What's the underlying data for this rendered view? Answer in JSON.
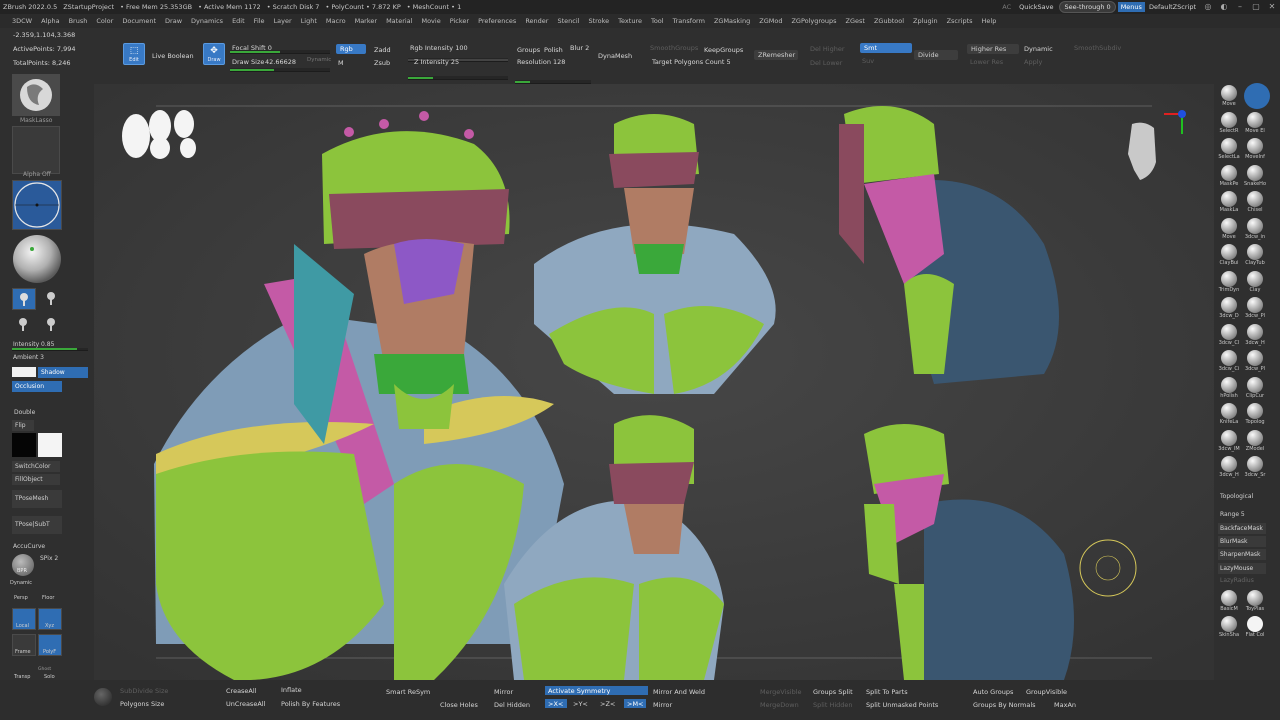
{
  "titlebar": {
    "app": "ZBrush 2022.0.5",
    "project": "ZStartupProject",
    "free_mem": "• Free Mem 25.353GB",
    "active_mem": "• Active Mem 1172",
    "scratch": "• Scratch Disk 7",
    "polycount": "• PolyCount • 7.872 KP",
    "meshcount": "• MeshCount • 1",
    "ac": "AC",
    "quicksave": "QuickSave",
    "see_through": "See-through  0",
    "menus": "Menus",
    "script": "DefaultZScript"
  },
  "menubar": [
    "3DCW",
    "Alpha",
    "Brush",
    "Color",
    "Document",
    "Draw",
    "Dynamics",
    "Edit",
    "File",
    "Layer",
    "Light",
    "Macro",
    "Marker",
    "Material",
    "Movie",
    "Picker",
    "Preferences",
    "Render",
    "Stencil",
    "Stroke",
    "Texture",
    "Tool",
    "Transform",
    "ZGMasking",
    "ZGMod",
    "ZGPolygroups",
    "ZGest",
    "ZGubtool",
    "Zplugin",
    "Zscripts",
    "Help"
  ],
  "info": {
    "coords": "-2.359,1.104,3.368",
    "active_points": "ActivePoints: 7,994",
    "total_points": "TotalPoints: 8,246"
  },
  "toolbar": {
    "edit": "Edit",
    "live_boolean": "Live Boolean",
    "draw": "Draw",
    "focal_shift": "Focal Shift 0",
    "draw_size": "Draw Size",
    "draw_size_value": "42.66628",
    "dynamic": "Dynamic",
    "rgb": "Rgb",
    "m": "M",
    "zadd": "Zadd",
    "zsub": "Zsub",
    "rgb_intensity": "Rgb Intensity 100",
    "z_intensity": "Z Intensity 25",
    "groups": "Groups",
    "polish": "Polish",
    "blur": "Blur 2",
    "resolution": "Resolution 128",
    "dynamesh": "DynaMesh",
    "smooth_groups": "SmoothGroups",
    "keep_groups": "KeepGroups",
    "target_polygons": "Target Polygons Count 5",
    "zremesher": "ZRemesher",
    "del_higher": "Del Higher",
    "del_lower": "Del Lower",
    "smt": "Smt",
    "suv": "Suv",
    "divide": "Divide",
    "higher_res": "Higher Res",
    "lower_res": "Lower Res",
    "dynamic2": "Dynamic",
    "apply": "Apply",
    "smooth_subdiv": "SmoothSubdiv"
  },
  "left": {
    "mask_lasso": "MaskLasso",
    "alpha_off": "Alpha Off",
    "intensity": "Intensity 0.85",
    "ambient": "Ambient 3",
    "shadow": "Shadow",
    "occlusion": "Occlusion",
    "double": "Double",
    "flip": "Flip",
    "switch_color": "SwitchColor",
    "fill_object": "FillObject",
    "tpose_mesh": "TPoseMesh",
    "tpose_subt": "TPose|SubT",
    "accucurve": "AccuCurve",
    "spix": "SPix 2",
    "bpr": "BPR",
    "dynamic": "Dynamic",
    "persp": "Persp",
    "floor": "Floor",
    "local": "Local",
    "xyz": "Xyz",
    "frame": "Frame",
    "polyf": "PolyF",
    "transp": "Transp",
    "solo": "Solo",
    "ghost": "Ghost"
  },
  "right": {
    "brushes": [
      {
        "l": "Move",
        "r": ""
      },
      {
        "l": "SelectR",
        "r": "Move El"
      },
      {
        "l": "SelectLa",
        "r": "MoveInf"
      },
      {
        "l": "MaskPe",
        "r": "SnakeHo"
      },
      {
        "l": "MaskLa",
        "r": "Chisel"
      },
      {
        "l": "Move",
        "r": "3dcw_in"
      },
      {
        "l": "ClayBui",
        "r": "ClayTub"
      },
      {
        "l": "TrimDyn",
        "r": "Clay"
      },
      {
        "l": "3dcw_D",
        "r": "3dcw_Pl"
      },
      {
        "l": "3dcw_Cl",
        "r": "3dcw_H"
      },
      {
        "l": "3dcw_Ci",
        "r": "3dcw_Pl"
      },
      {
        "l": "hPolish",
        "r": "ClipCur"
      },
      {
        "l": "KnifeLa",
        "r": "Topolog"
      },
      {
        "l": "3dcw_IM",
        "r": "ZModel"
      },
      {
        "l": "3dcw_H",
        "r": "3dcw_Sr"
      }
    ],
    "topological": "Topological",
    "range": "Range 5",
    "backface_mask": "BackfaceMask",
    "blur_mask": "BlurMask",
    "sharpen_mask": "SharpenMask",
    "lazy_mouse": "LazyMouse",
    "lazy_radius": "LazyRadius",
    "basic_m": "BasicM",
    "toy_plas": "ToyPlas",
    "skin_sha": "SkinSha",
    "flat_col": "Flat Col"
  },
  "bottom": {
    "subdivide_size": "SubDivide Size",
    "polygons_size": "Polygons Size",
    "crease_all": "CreaseAll",
    "uncrease_all": "UnCreaseAll",
    "inflate": "Inflate",
    "polish_by_features": "Polish By Features",
    "smart_resym": "Smart ReSym",
    "close_holes": "Close Holes",
    "mirror": "Mirror",
    "del_hidden": "Del Hidden",
    "activate_symmetry": "Activate Symmetry",
    "mx": ">X<",
    "my": ">Y<",
    "mz": ">Z<",
    "m": ">M<",
    "mirror_and_weld": "Mirror And Weld",
    "mirror2": "Mirror",
    "merge_visible": "MergeVisible",
    "merge_down": "MergeDown",
    "groups_split": "Groups Split",
    "split_hidden": "Split Hidden",
    "split_to_parts": "Split To Parts",
    "split_unmasked_points": "Split Unmasked Points",
    "auto_groups": "Auto Groups",
    "groups_by_normals": "Groups By Normals",
    "group_visible": "GroupVisible",
    "max_an": "MaxAn"
  },
  "colors": {
    "accent": "#3879c5",
    "helmet": "#8cc43c",
    "face": "#b07c64",
    "brow": "#8a4a5e",
    "purple": "#8d58c6",
    "teal": "#3f9aa4",
    "magenta": "#c45aa6",
    "yellow": "#d6c85a",
    "cape_blue": "#3a5670",
    "torso_blue": "#8fa8c0"
  }
}
